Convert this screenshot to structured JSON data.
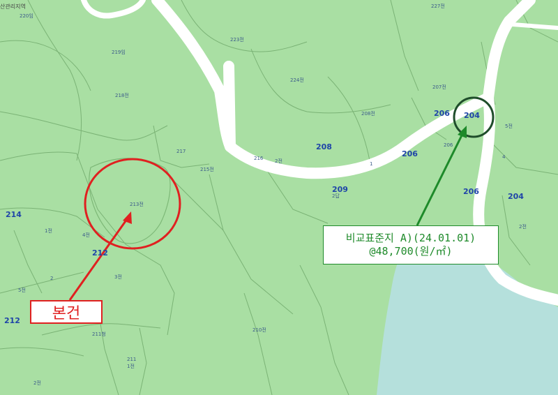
{
  "map": {
    "region_label": "산관리지역",
    "parcels_small": [
      "220임",
      "219임",
      "218전",
      "217",
      "215전",
      "216",
      "2전",
      "1",
      "223전",
      "224전",
      "208전",
      "227전",
      "207전",
      "206",
      "5전",
      "4",
      "2전",
      "213전",
      "1전",
      "4전",
      "3전",
      "2",
      "5전",
      "211",
      "1전",
      "2전",
      "210전",
      "211청",
      "2답"
    ],
    "parcels_big": [
      "214",
      "212",
      "212",
      "208",
      "206",
      "206",
      "209",
      "206",
      "204",
      "204"
    ],
    "subject": {
      "label": "본건"
    },
    "comparable": {
      "parcel": "204",
      "title": "비교표준지 A)(24.01.01)",
      "price": "@48,700(원/㎡)"
    }
  },
  "colors": {
    "land": "#a9dfa3",
    "water": "#b5e0dc",
    "road": "#ffffff",
    "subject": "#e02020",
    "comparable": "#1e8a2a",
    "comparable_circle": "#1f4d2b"
  }
}
